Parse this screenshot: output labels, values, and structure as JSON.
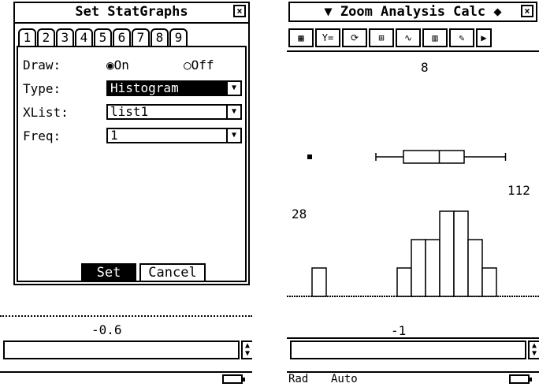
{
  "left": {
    "dialog_title": "Set StatGraphs",
    "tabs": [
      "1",
      "2",
      "3",
      "4",
      "5",
      "6",
      "7",
      "8",
      "9"
    ],
    "draw": {
      "label": "Draw:",
      "on": "On",
      "off": "Off",
      "selected": "On"
    },
    "type": {
      "label": "Type:",
      "value": "Histogram"
    },
    "xlist": {
      "label": "XList:",
      "value": "list1"
    },
    "freq": {
      "label": "Freq:",
      "value": "1"
    },
    "buttons": {
      "set": "Set",
      "cancel": "Cancel"
    },
    "bottom_value": "-0.6"
  },
  "right": {
    "window_title": "Zoom Analysis Calc",
    "toolbar_icons": [
      "table-icon",
      "y-equals-icon",
      "redraw-icon",
      "zoom-box-icon",
      "trace-curve-icon",
      "stat-menu-icon",
      "sketch-icon",
      "play-arrow-icon"
    ],
    "labels": {
      "top": "8",
      "right": "112",
      "left": "28",
      "bottom": "-1"
    },
    "status": {
      "mode1": "Rad",
      "mode2": "Auto"
    },
    "chart_data": {
      "type": "histogram",
      "bins": [
        1,
        0,
        0,
        0,
        0,
        0,
        1,
        2,
        2,
        3,
        3,
        2,
        1
      ],
      "boxplot": {
        "min": 30,
        "q1": 40,
        "median": 53,
        "q3": 62,
        "max": 77,
        "outlier": 6
      }
    }
  }
}
